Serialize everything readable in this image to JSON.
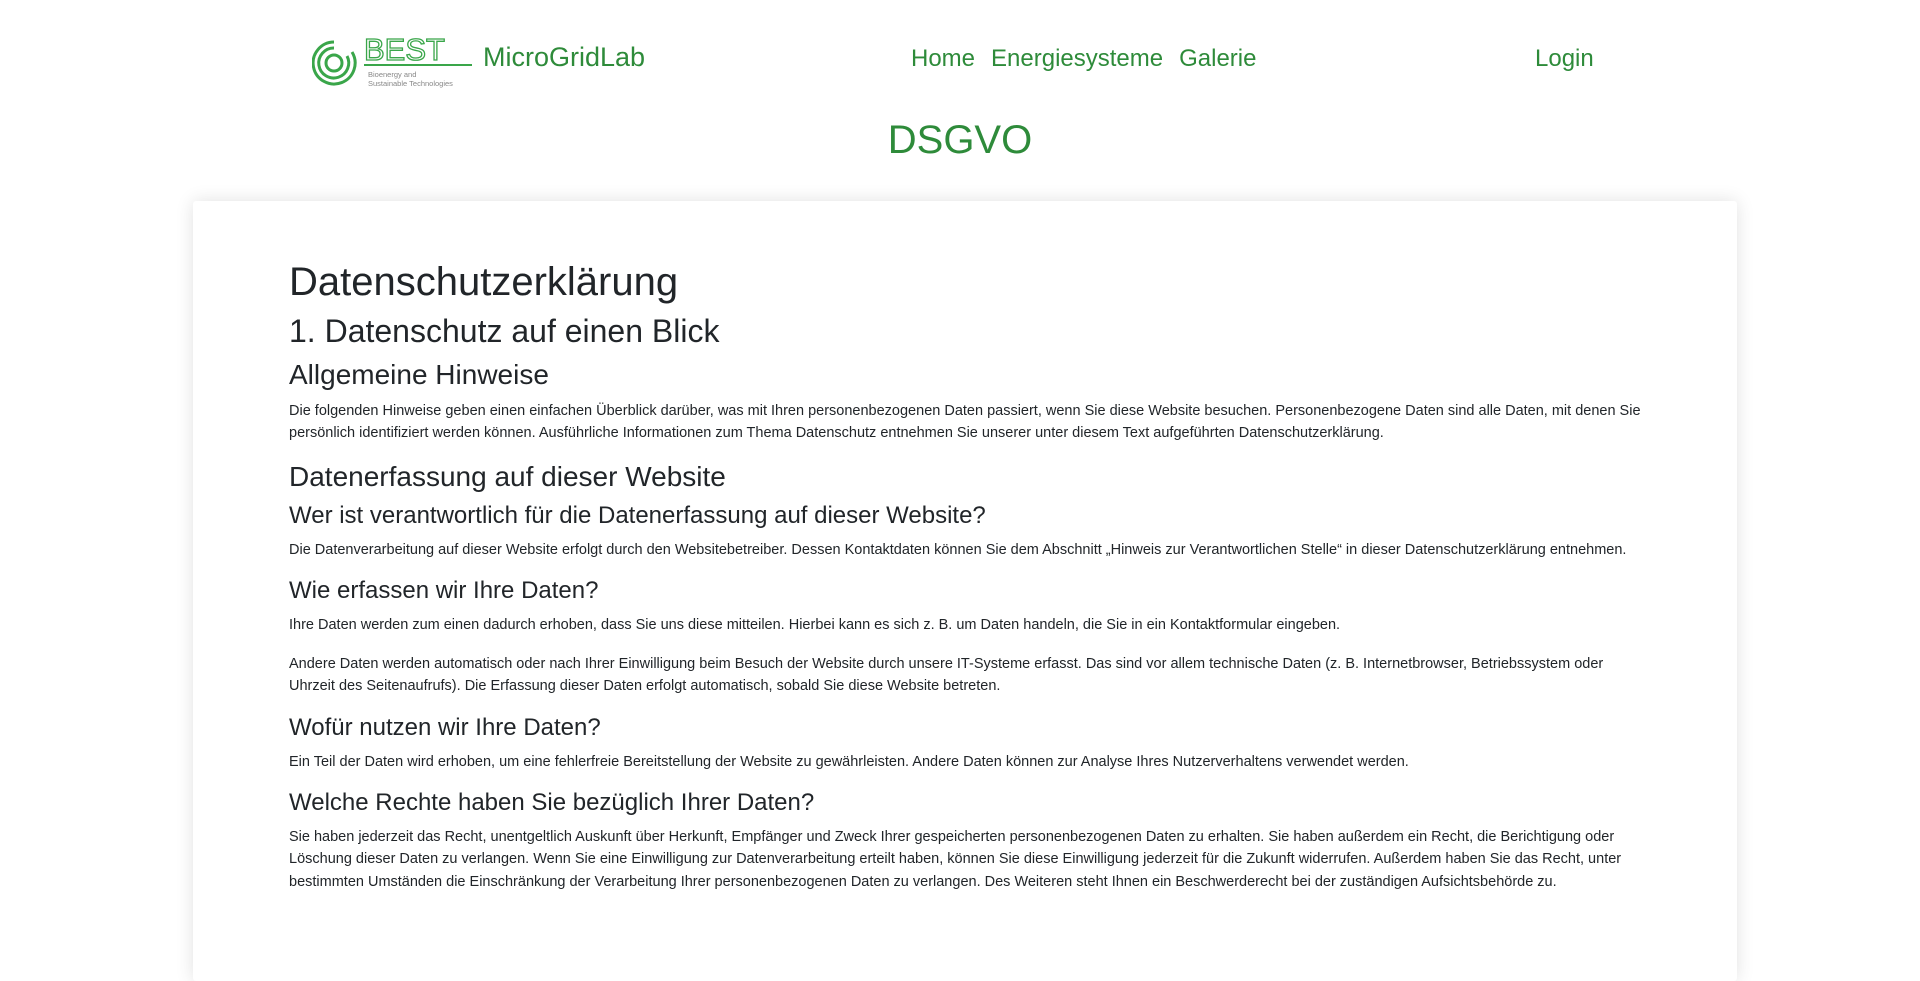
{
  "header": {
    "logo_text": "BEST",
    "logo_subtext_line1": "Bioenergy and",
    "logo_subtext_line2": "Sustainable Technologies",
    "brand": "MicroGridLab",
    "nav": [
      "Home",
      "Energiesysteme",
      "Galerie"
    ],
    "login": "Login"
  },
  "page_title": "DSGVO",
  "colors": {
    "accent": "#2e8b3a",
    "text": "#212529"
  },
  "content": {
    "title": "Datenschutzerklärung",
    "section1": "1. Datenschutz auf einen Blick",
    "general_heading": "Allgemeine Hinweise",
    "general_text": "Die folgenden Hinweise geben einen einfachen Überblick darüber, was mit Ihren personenbezogenen Daten passiert, wenn Sie diese Website besuchen. Personenbezogene Daten sind alle Daten, mit denen Sie persönlich identifiziert werden können. Ausführliche Informationen zum Thema Datenschutz entnehmen Sie unserer unter diesem Text aufgeführten Datenschutzerklärung.",
    "collection_heading": "Datenerfassung auf dieser Website",
    "q1": "Wer ist verantwortlich für die Datenerfassung auf dieser Website?",
    "a1": "Die Datenverarbeitung auf dieser Website erfolgt durch den Websitebetreiber. Dessen Kontaktdaten können Sie dem Abschnitt „Hinweis zur Verantwortlichen Stelle“ in dieser Datenschutzerklärung entnehmen.",
    "q2": "Wie erfassen wir Ihre Daten?",
    "a2_1": "Ihre Daten werden zum einen dadurch erhoben, dass Sie uns diese mitteilen. Hierbei kann es sich z. B. um Daten handeln, die Sie in ein Kontaktformular eingeben.",
    "a2_2": "Andere Daten werden automatisch oder nach Ihrer Einwilligung beim Besuch der Website durch unsere IT-Systeme erfasst. Das sind vor allem technische Daten (z. B. Internetbrowser, Betriebssystem oder Uhrzeit des Seitenaufrufs). Die Erfassung dieser Daten erfolgt automatisch, sobald Sie diese Website betreten.",
    "q3": "Wofür nutzen wir Ihre Daten?",
    "a3": "Ein Teil der Daten wird erhoben, um eine fehlerfreie Bereitstellung der Website zu gewährleisten. Andere Daten können zur Analyse Ihres Nutzerverhaltens verwendet werden.",
    "q4": "Welche Rechte haben Sie bezüglich Ihrer Daten?",
    "a4": "Sie haben jederzeit das Recht, unentgeltlich Auskunft über Herkunft, Empfänger und Zweck Ihrer gespeicherten personenbezogenen Daten zu erhalten. Sie haben außerdem ein Recht, die Berichtigung oder Löschung dieser Daten zu verlangen. Wenn Sie eine Einwilligung zur Datenverarbeitung erteilt haben, können Sie diese Einwilligung jederzeit für die Zukunft widerrufen. Außerdem haben Sie das Recht, unter bestimmten Umständen die Einschränkung der Verarbeitung Ihrer personenbezogenen Daten zu verlangen. Des Weiteren steht Ihnen ein Beschwerderecht bei der zuständigen Aufsichtsbehörde zu."
  }
}
